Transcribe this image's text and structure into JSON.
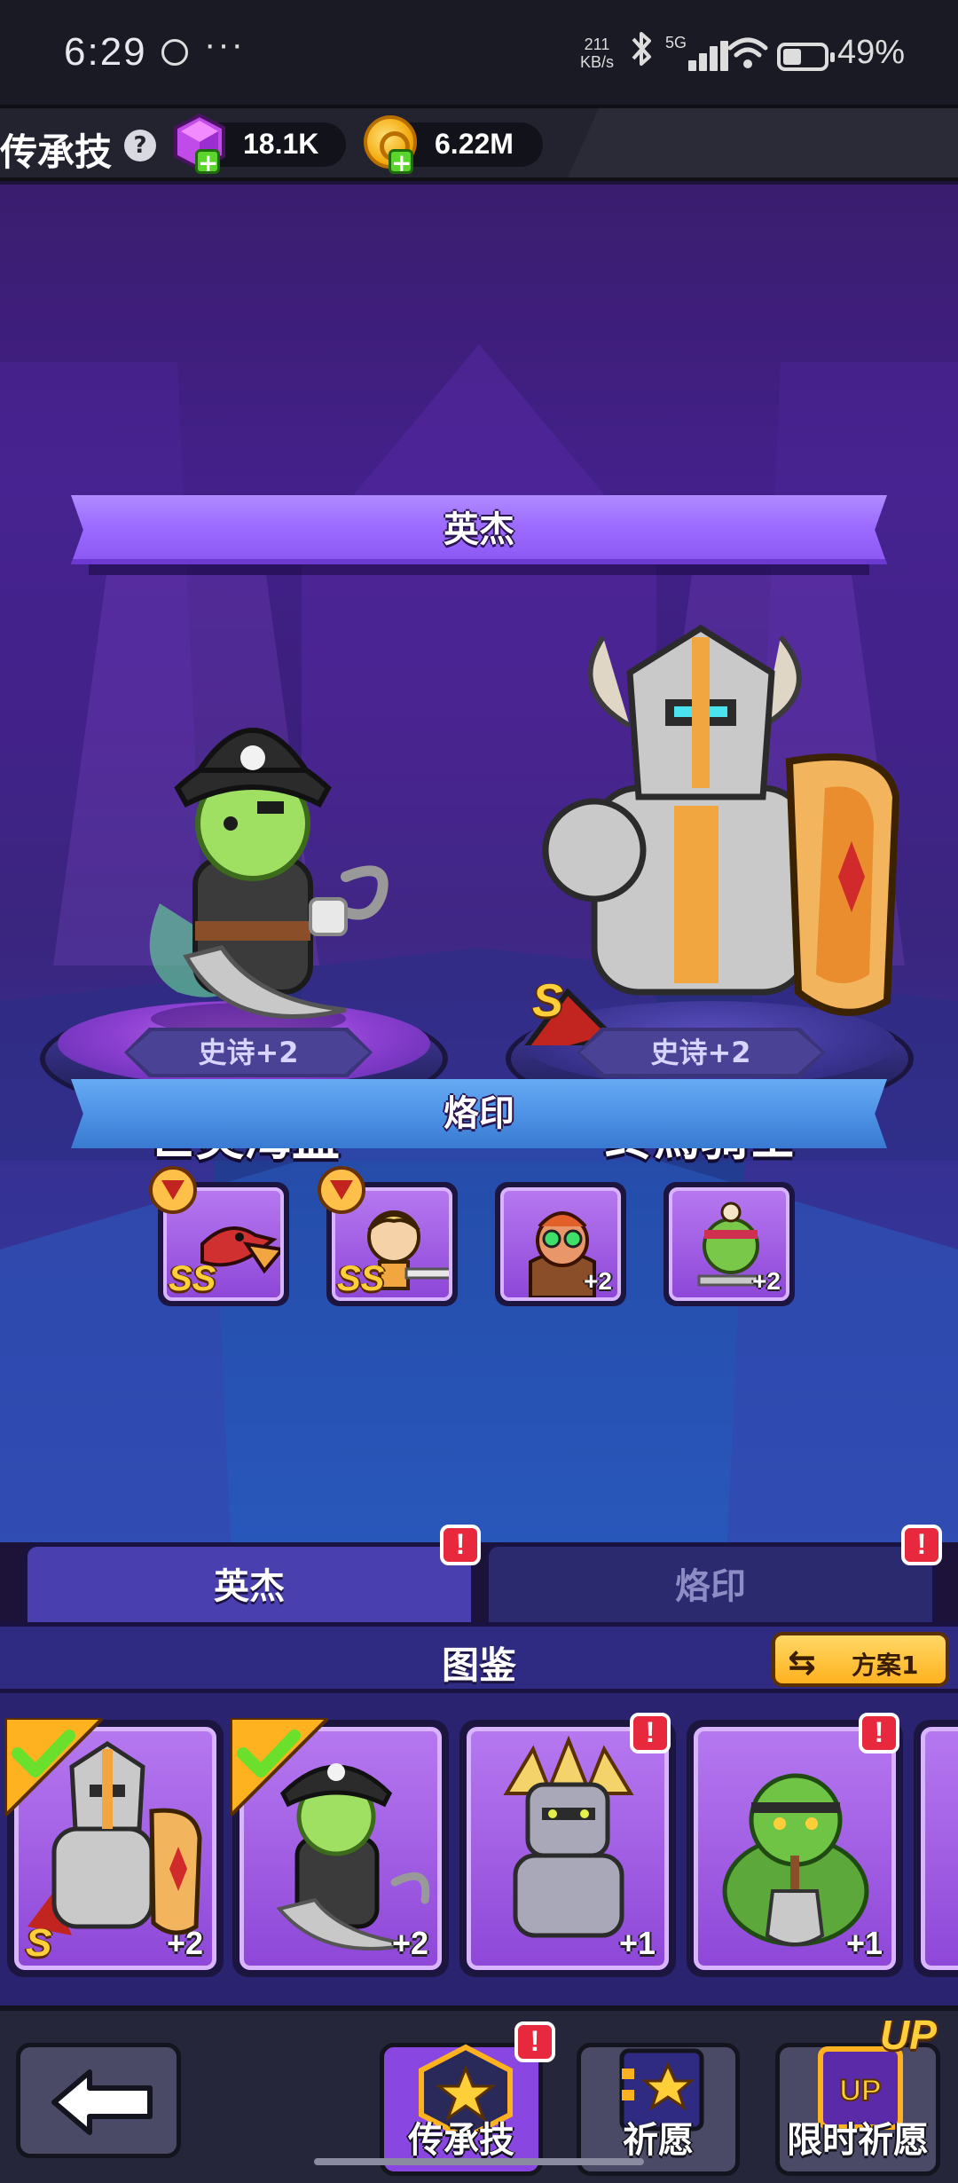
{
  "status_bar": {
    "time": "6:29",
    "more": "···",
    "net_speed_value": "211",
    "net_speed_unit": "KB/s",
    "signal_label": "5G",
    "battery": "49%"
  },
  "resource_bar": {
    "title": "传承技",
    "help": "?",
    "gems": "18.1K",
    "coins": "6.22M"
  },
  "stage": {
    "heroes_banner": "英杰",
    "brands_banner": "烙印",
    "heroes": [
      {
        "name": "亡灵海盗",
        "rarity": "史诗+2"
      },
      {
        "name": "终焉骑士",
        "rarity": "史诗+2",
        "grade": "S"
      }
    ],
    "brands": [
      {
        "grade": "SS"
      },
      {
        "grade": "SS"
      },
      {
        "level": "+2"
      },
      {
        "level": "+2"
      }
    ]
  },
  "tabs": {
    "heroes": "英杰",
    "brands": "烙印"
  },
  "codex": {
    "title": "图鉴",
    "plan_label": "方案1",
    "cards": [
      {
        "grade": "S",
        "level": "+2"
      },
      {
        "level": "+2"
      },
      {
        "level": "+1"
      },
      {
        "level": "+1"
      }
    ]
  },
  "bottom_nav": {
    "legacy": "传承技",
    "wish": "祈愿",
    "limited_wish": "限时祈愿",
    "up_badge": "UP",
    "up_mini": "UP"
  },
  "colors": {
    "accent_purple": "#9c6bff",
    "accent_blue": "#4e93e6",
    "alert_red": "#e8283c",
    "gold": "#ffcf3a"
  }
}
